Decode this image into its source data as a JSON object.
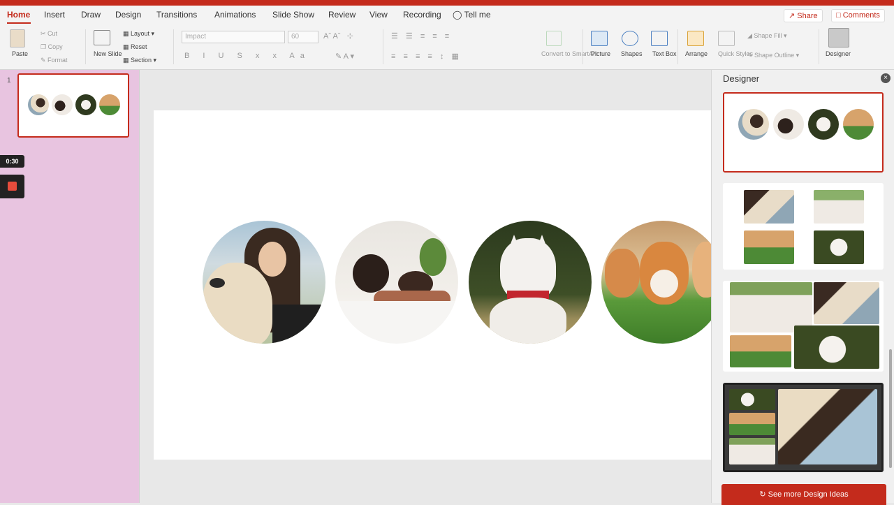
{
  "tabs": [
    {
      "label": "Home",
      "active": true
    },
    {
      "label": "Insert"
    },
    {
      "label": "Draw"
    },
    {
      "label": "Design"
    },
    {
      "label": "Transitions"
    },
    {
      "label": "Animations"
    },
    {
      "label": "Slide Show"
    },
    {
      "label": "Review"
    },
    {
      "label": "View"
    },
    {
      "label": "Recording"
    },
    {
      "label": "Tell me"
    }
  ],
  "share_label": "Share",
  "comments_label": "Comments",
  "ribbon": {
    "paste": "Paste",
    "cut": "Cut",
    "copy": "Copy",
    "format": "Format",
    "new_slide": "New Slide",
    "layout": "Layout",
    "reset": "Reset",
    "section": "Section",
    "font_name": "Impact",
    "font_size": "60",
    "convert_smartart": "Convert to SmartArt",
    "picture": "Picture",
    "shapes": "Shapes",
    "text_box": "Text Box",
    "arrange": "Arrange",
    "quick_styles": "Quick Styles",
    "shape_fill": "Shape Fill",
    "shape_outline": "Shape Outline",
    "designer": "Designer"
  },
  "slides_panel": {
    "slide_number": "1",
    "timer": "0:30"
  },
  "designer": {
    "title": "Designer",
    "see_more": "See more Design Ideas"
  },
  "colors": {
    "accent": "#c42b1c",
    "panel_pink": "#e8c4e0"
  }
}
